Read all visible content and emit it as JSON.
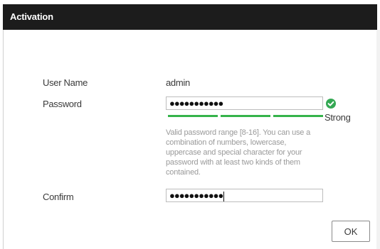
{
  "dialog": {
    "title": "Activation"
  },
  "form": {
    "username_label": "User Name",
    "username_value": "admin",
    "password_label": "Password",
    "password_value": "●●●●●●●●●●●",
    "confirm_label": "Confirm",
    "confirm_value": "●●●●●●●●●●●"
  },
  "strength": {
    "label": "Strong",
    "level": 3,
    "max": 3,
    "color": "#35b34a"
  },
  "hint": {
    "text": "Valid password range [8-16]. You can use a combination of numbers, lowercase, uppercase and special character for your password with at least two kinds of them contained."
  },
  "buttons": {
    "ok_label": "OK"
  },
  "icons": {
    "valid": "check-circle-icon"
  },
  "colors": {
    "title_bar": "#1c1c1c",
    "valid_check": "#34a853"
  }
}
